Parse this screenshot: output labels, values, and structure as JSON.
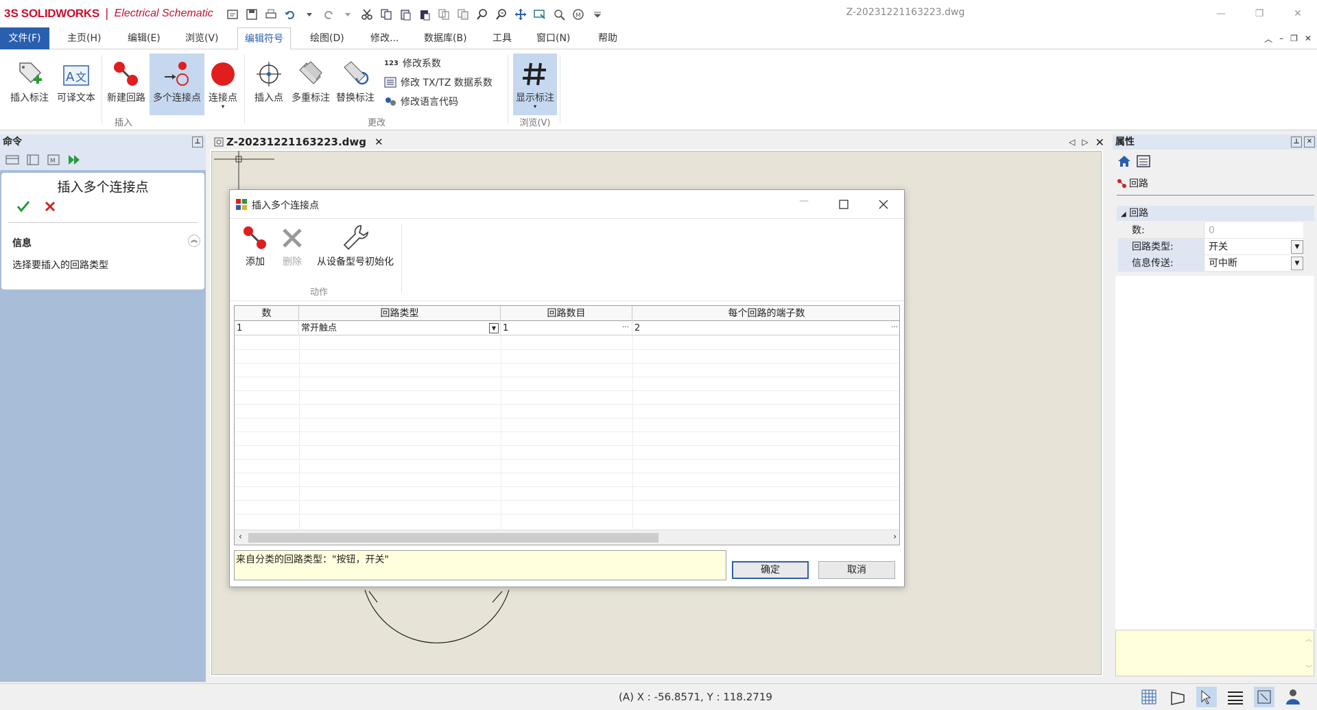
{
  "app": {
    "logo_ds": "3S",
    "brand": "SOLIDWORKS",
    "separator": "|",
    "product": "Electrical Schematic",
    "doc_title": "Z-20231221163223.dwg"
  },
  "menu": {
    "file": "文件(F)",
    "items": [
      "主页(H)",
      "编辑(E)",
      "浏览(V)",
      "编辑符号",
      "绘图(D)",
      "修改...",
      "数据库(B)",
      "工具",
      "窗口(N)",
      "帮助"
    ]
  },
  "ribbon": {
    "insert_tag": "插入标注",
    "translatable_text": "可译文本",
    "new_circuit": "新建回路",
    "multi_connection": "多个连接点",
    "connection_point": "连接点",
    "group_insert": "插入",
    "insert_point": "插入点",
    "multi_tag": "多重标注",
    "replace_tag": "替换标注",
    "modify_coeff": "修改系数",
    "modify_txtz": "修改 TX/TZ 数据系数",
    "modify_lang": "修改语言代码",
    "group_modify": "更改",
    "show_tag": "显示标注",
    "group_browse": "浏览(V)"
  },
  "left_panel": {
    "header": "命令",
    "title": "插入多个连接点",
    "info_header": "信息",
    "info_text": "选择要插入的回路类型"
  },
  "tab": {
    "label": "Z-20231221163223.dwg"
  },
  "right_panel": {
    "header": "属性",
    "tab_label": "回路",
    "section": "回路",
    "rows": [
      {
        "key": "数:",
        "value": "0"
      },
      {
        "key": "回路类型:",
        "value": "开关"
      },
      {
        "key": "信息传送:",
        "value": "可中断"
      }
    ]
  },
  "dialog": {
    "title": "插入多个连接点",
    "add": "添加",
    "delete": "删除",
    "init_from_model": "从设备型号初始化",
    "group_action": "动作",
    "columns": [
      "数",
      "回路类型",
      "回路数目",
      "每个回路的端子数"
    ],
    "rows": [
      {
        "num": "1",
        "type": "常开触点",
        "count": "1",
        "terminals": "2"
      }
    ],
    "info": "来自分类的回路类型：\"按钮，开关\"",
    "ok": "确定",
    "cancel": "取消"
  },
  "status": {
    "coords": "(A) X : -56.8571, Y : 118.2719"
  },
  "colors": {
    "brand_red": "#c8102e",
    "accent_blue": "#2a5fb0",
    "panel_blue": "#a8bdd8",
    "canvas_bg": "#e7e4d7",
    "info_yellow": "#ffffde"
  }
}
